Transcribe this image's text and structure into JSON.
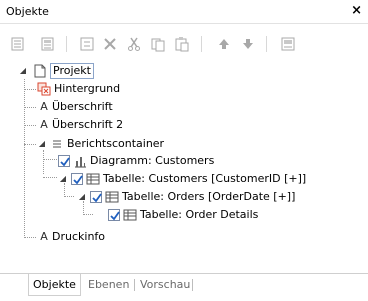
{
  "window": {
    "title": "Objekte",
    "close_glyph": "×"
  },
  "toolbar": {
    "icons": [
      "new-object-icon",
      "new-object-2-icon",
      "properties-icon",
      "delete-icon",
      "cut-icon",
      "copy-icon",
      "paste-icon",
      "move-up-icon",
      "move-down-icon",
      "export-icon"
    ]
  },
  "tree": {
    "items": [
      {
        "label": "Projekt",
        "icon": "page-icon"
      },
      {
        "label": "Hintergrund",
        "icon": "background-icon"
      },
      {
        "label": "Überschrift",
        "icon": "text-icon"
      },
      {
        "label": "Überschrift 2",
        "icon": "text-icon"
      },
      {
        "label": "Berichtscontainer",
        "icon": "container-icon"
      },
      {
        "label": "Diagramm: Customers",
        "icon": "chart-icon",
        "checked": true
      },
      {
        "label": "Tabelle: Customers [CustomerID [+]]",
        "icon": "table-icon",
        "checked": true
      },
      {
        "label": "Tabelle: Orders [OrderDate [+]]",
        "icon": "table-icon",
        "checked": true
      },
      {
        "label": "Tabelle: Order Details",
        "icon": "table-icon",
        "checked": true
      },
      {
        "label": "Druckinfo",
        "icon": "text-icon"
      }
    ],
    "text_glyph": "A"
  },
  "tabs": [
    {
      "label": "Objekte",
      "active": true
    },
    {
      "label": "Ebenen",
      "active": false
    },
    {
      "label": "Vorschau",
      "active": false
    }
  ],
  "colors": {
    "accent_red": "#d9462f",
    "check_blue": "#1f5fbf",
    "border": "#cfcfcf"
  }
}
